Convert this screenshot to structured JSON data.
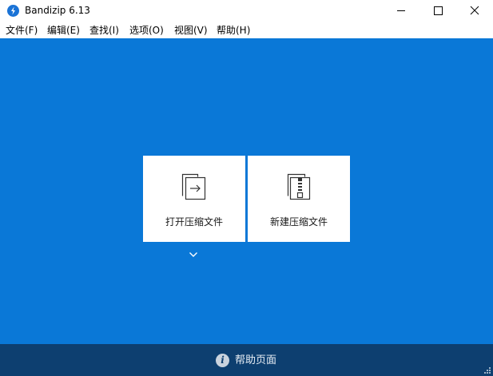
{
  "window": {
    "title": "Bandizip 6.13",
    "logo_icon": "bandizip-logo",
    "controls": [
      "minimize-icon",
      "maximize-icon",
      "close-icon"
    ]
  },
  "menu": {
    "file": "文件(F)",
    "edit": "编辑(E)",
    "find": "查找(I)",
    "options": "选项(O)",
    "view": "视图(V)",
    "help": "帮助(H)"
  },
  "main": {
    "background": "#0a78d7",
    "open_archive": {
      "label": "打开压缩文件",
      "icon": "open-archive-icon"
    },
    "new_archive": {
      "label": "新建压缩文件",
      "icon": "new-archive-icon"
    },
    "dropdown_icon": "chevron-down-icon"
  },
  "footer": {
    "background": "#0d3f70",
    "help_icon": "info-icon",
    "help_label": "帮助页面"
  }
}
